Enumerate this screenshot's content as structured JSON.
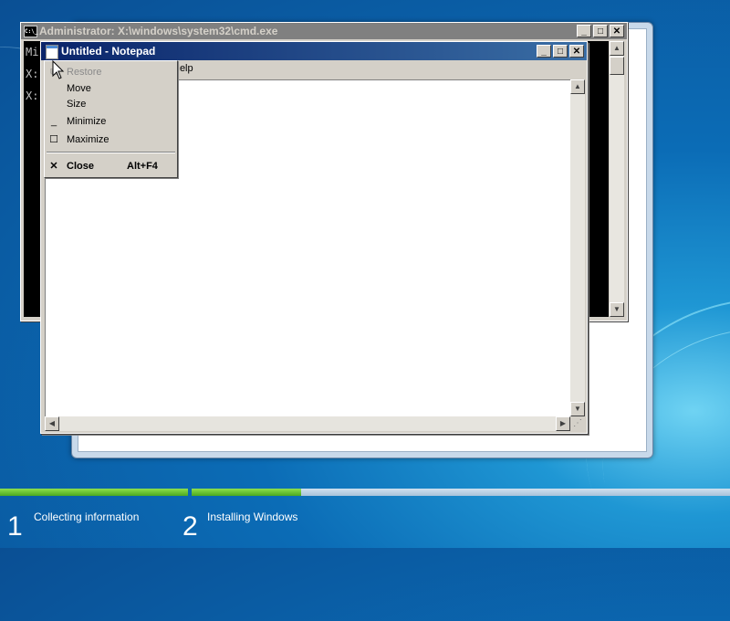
{
  "cmd": {
    "title": "Administrator: X:\\windows\\system32\\cmd.exe",
    "icon_text": "C:\\_",
    "lines": [
      "Mi",
      "X:",
      "X:"
    ]
  },
  "notepad": {
    "title": "Untitled - Notepad",
    "menu_visible": "Help"
  },
  "system_menu": {
    "items": [
      {
        "label": "Restore",
        "icon": "restore-icon",
        "glyph": "⧉",
        "enabled": false
      },
      {
        "label": "Move",
        "icon": "",
        "glyph": "",
        "enabled": true
      },
      {
        "label": "Size",
        "icon": "",
        "glyph": "",
        "enabled": true
      },
      {
        "label": "Minimize",
        "icon": "minimize-icon",
        "glyph": "_",
        "enabled": true
      },
      {
        "label": "Maximize",
        "icon": "maximize-icon",
        "glyph": "☐",
        "enabled": true
      },
      {
        "label": "Close",
        "icon": "close-icon",
        "glyph": "✕",
        "shortcut": "Alt+F4",
        "enabled": true
      }
    ]
  },
  "window_buttons": {
    "minimize": "_",
    "maximize": "□",
    "close": "✕"
  },
  "progress": {
    "steps": [
      {
        "number": "1",
        "label": "Collecting information"
      },
      {
        "number": "2",
        "label": "Installing Windows"
      }
    ]
  },
  "colors": {
    "progress_green": "#6cc83a",
    "title_active": "#0a246a",
    "title_inactive": "#808080"
  }
}
